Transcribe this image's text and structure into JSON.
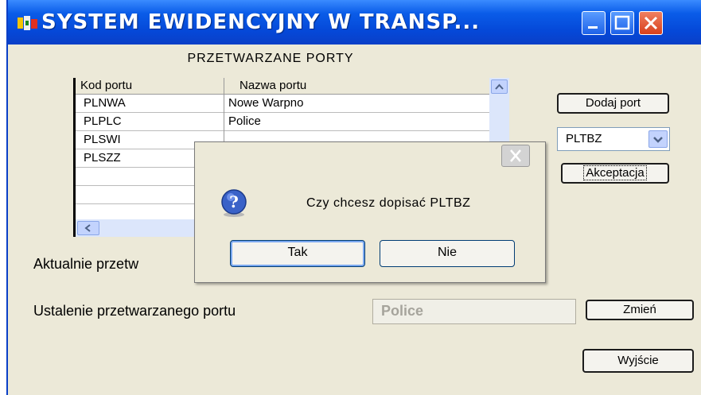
{
  "window": {
    "title": "SYSTEM EWIDENCYJNY W TRANSP..."
  },
  "ports_group": {
    "label": "PRZETWARZANE PORTY"
  },
  "table": {
    "columns": [
      "Kod portu",
      "Nazwa portu"
    ],
    "rows": [
      [
        "PLNWA",
        "Nowe Warpno"
      ],
      [
        "PLPLC",
        "Police"
      ],
      [
        "PLSWI",
        ""
      ],
      [
        "PLSZZ",
        ""
      ],
      [
        "",
        ""
      ],
      [
        "",
        ""
      ],
      [
        "",
        ""
      ]
    ]
  },
  "buttons": {
    "add_port": "Dodaj port",
    "accept": "Akceptacja",
    "change": "Zmień",
    "exit": "Wyjście"
  },
  "combo": {
    "value": "PLTBZ"
  },
  "labels": {
    "current": "Aktualnie przetw",
    "set_port": "Ustalenie przetwarzanego portu"
  },
  "set_port_value": "Police",
  "dialog": {
    "message": "Czy chcesz dopisać PLTBZ",
    "yes": "Tak",
    "no": "Nie"
  }
}
